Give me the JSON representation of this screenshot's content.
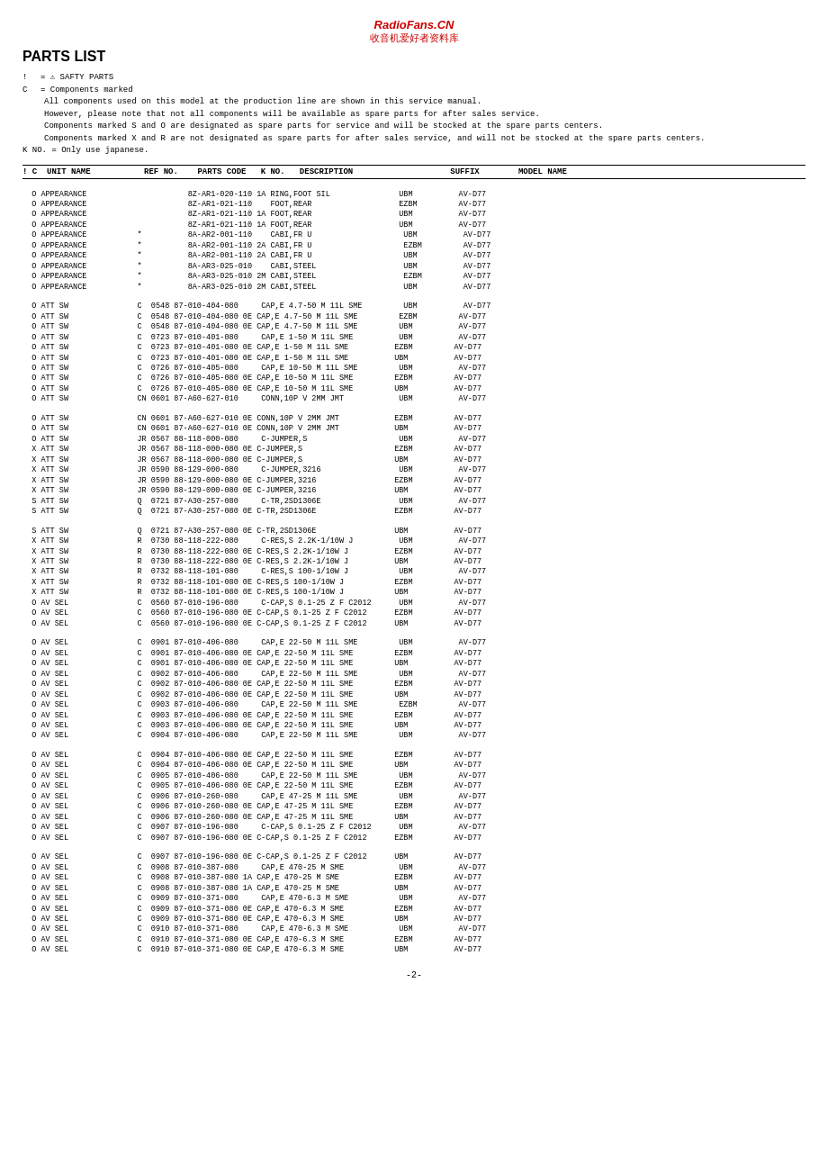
{
  "site": {
    "title": "RadioFans.CN",
    "subtitle": "收音机爱好者资料库"
  },
  "page": {
    "title": "PARTS LIST",
    "page_number": "-2-"
  },
  "legend": {
    "exclamation": "!",
    "c_label": "C",
    "safty": "= ⚠ SAFTY PARTS",
    "components": "= Components marked",
    "note1": "All components used on this model at the production line are shown in this service manual.",
    "note2": "However, please note that not all components will be available as spare parts for after sales service.",
    "note3": "Components marked S and O are designated as spare parts for service and will be stocked at the spare parts centers.",
    "note4": "Components marked X and R are not designated as spare parts for after sales service, and will not be stocked at the spare parts centers.",
    "k_note": "K NO. = Only use japanese."
  },
  "col_header": "! C  UNIT NAME           REF NO.    PARTS CODE   K NO.   DESCRIPTION                    SUFFIX        MODEL NAME",
  "sections": [
    {
      "id": "appearance",
      "lines": [
        "  O APPEARANCE                      8Z-AR1-020-110 1A RING,FOOT SIL               UBM          AV-D77",
        "  O APPEARANCE                      8Z-AR1-021-110    FOOT,REAR                   EZBM         AV-D77",
        "  O APPEARANCE                      8Z-AR1-021-110 1A FOOT,REAR                   UBM          AV-D77",
        "  O APPEARANCE                      8Z-AR1-021-110 1A FOOT,REAR                   UBM          AV-D77",
        "  O APPEARANCE           *          8A-AR2-001-110    CABI,FR U                    UBM          AV-D77",
        "  O APPEARANCE           *          8A-AR2-001-110 2A CABI,FR U                    EZBM         AV-D77",
        "  O APPEARANCE           *          8A-AR2-001-110 2A CABI,FR U                    UBM          AV-D77",
        "  O APPEARANCE           *          8A-AR3-025-010    CABI,STEEL                   UBM          AV-D77",
        "  O APPEARANCE           *          8A-AR3-025-010 2M CABI,STEEL                   EZBM         AV-D77",
        "  O APPEARANCE           *          8A-AR3-025-010 2M CABI,STEEL                   UBM          AV-D77"
      ]
    },
    {
      "id": "att_sw_1",
      "lines": [
        "  O ATT SW               C  0548 87-010-404-080     CAP,E 4.7-50 M 11L SME         UBM          AV-D77",
        "  O ATT SW               C  0548 87-010-404-080 0E CAP,E 4.7-50 M 11L SME         EZBM         AV-D77",
        "  O ATT SW               C  0548 87-010-404-080 0E CAP,E 4.7-50 M 11L SME         UBM          AV-D77",
        "  O ATT SW               C  0723 87-010-401-080     CAP,E 1-50 M 11L SME          UBM          AV-D77",
        "  O ATT SW               C  0723 87-010-401-080 0E CAP,E 1-50 M 11L SME          EZBM         AV-D77",
        "  O ATT SW               C  0723 87-010-401-080 0E CAP,E 1-50 M 11L SME          UBM          AV-D77",
        "  O ATT SW               C  0726 87-010-405-080     CAP,E 10-50 M 11L SME         UBM          AV-D77",
        "  O ATT SW               C  0726 87-010-405-080 0E CAP,E 10-50 M 11L SME         EZBM         AV-D77",
        "  O ATT SW               C  0726 87-010-405-080 0E CAP,E 10-50 M 11L SME         UBM          AV-D77",
        "  O ATT SW               CN 0601 87-A60-627-010     CONN,10P V 2MM JMT            UBM          AV-D77"
      ]
    },
    {
      "id": "att_sw_2",
      "lines": [
        "  O ATT SW               CN 0601 87-A60-627-010 0E CONN,10P V 2MM JMT            EZBM         AV-D77",
        "  O ATT SW               CN 0601 87-A60-627-010 0E CONN,10P V 2MM JMT            UBM          AV-D77",
        "  O ATT SW               JR 0567 88-118-000-080     C-JUMPER,S                    UBM          AV-D77",
        "  X ATT SW               JR 0567 88-118-000-080 0E C-JUMPER,S                    EZBM         AV-D77",
        "  X ATT SW               JR 0567 88-118-000-080 0E C-JUMPER,S                    UBM          AV-D77",
        "  X ATT SW               JR 0590 88-129-000-080     C-JUMPER,3216                 UBM          AV-D77",
        "  X ATT SW               JR 0590 88-129-000-080 0E C-JUMPER,3216                 EZBM         AV-D77",
        "  X ATT SW               JR 0590 88-129-000-080 0E C-JUMPER,3216                 UBM          AV-D77",
        "  S ATT SW               Q  0721 87-A30-257-080     C-TR,2SD1306E                 UBM          AV-D77",
        "  S ATT SW               Q  0721 87-A30-257-080 0E C-TR,2SD1306E                 EZBM         AV-D77"
      ]
    },
    {
      "id": "att_sw_3",
      "lines": [
        "  S ATT SW               Q  0721 87-A30-257-080 0E C-TR,2SD1306E                 UBM          AV-D77",
        "  X ATT SW               R  0730 88-118-222-080     C-RES,S 2.2K-1/10W J          UBM          AV-D77",
        "  X ATT SW               R  0730 88-118-222-080 0E C-RES,S 2.2K-1/10W J          EZBM         AV-D77",
        "  X ATT SW               R  0730 88-118-222-080 0E C-RES,S 2.2K-1/10W J          UBM          AV-D77",
        "  X ATT SW               R  0732 88-118-101-080     C-RES,S 100-1/10W J           UBM          AV-D77",
        "  X ATT SW               R  0732 88-118-101-080 0E C-RES,S 100-1/10W J           EZBM         AV-D77",
        "  X ATT SW               R  0732 88-118-101-080 0E C-RES,S 100-1/10W J           UBM          AV-D77",
        "  O AV SEL               C  0560 87-010-196-080     C-CAP,S 0.1-25 Z F C2012      UBM          AV-D77",
        "  O AV SEL               C  0560 87-010-196-080 0E C-CAP,S 0.1-25 Z F C2012      EZBM         AV-D77",
        "  O AV SEL               C  0560 87-010-196-080 0E C-CAP,S 0.1-25 Z F C2012      UBM          AV-D77"
      ]
    },
    {
      "id": "av_sel_1",
      "lines": [
        "  O AV SEL               C  0901 87-010-406-080     CAP,E 22-50 M 11L SME         UBM          AV-D77",
        "  O AV SEL               C  0901 87-010-406-080 0E CAP,E 22-50 M 11L SME         EZBM         AV-D77",
        "  O AV SEL               C  0901 87-010-406-080 0E CAP,E 22-50 M 11L SME         UBM          AV-D77",
        "  O AV SEL               C  0902 87-010-406-080     CAP,E 22-50 M 11L SME         UBM          AV-D77",
        "  O AV SEL               C  0902 87-010-406-080 0E CAP,E 22-50 M 11L SME         EZBM         AV-D77",
        "  O AV SEL               C  0902 87-010-406-080 0E CAP,E 22-50 M 11L SME         UBM          AV-D77",
        "  O AV SEL               C  0903 87-010-406-080     CAP,E 22-50 M 11L SME         EZBM         AV-D77",
        "  O AV SEL               C  0903 87-010-406-080 0E CAP,E 22-50 M 11L SME         EZBM         AV-D77",
        "  O AV SEL               C  0903 87-010-406-080 0E CAP,E 22-50 M 11L SME         UBM          AV-D77",
        "  O AV SEL               C  0904 87-010-406-080     CAP,E 22-50 M 11L SME         UBM          AV-D77"
      ]
    },
    {
      "id": "av_sel_2",
      "lines": [
        "  O AV SEL               C  0904 87-010-406-080 0E CAP,E 22-50 M 11L SME         EZBM         AV-D77",
        "  O AV SEL               C  0904 87-010-406-080 0E CAP,E 22-50 M 11L SME         UBM          AV-D77",
        "  O AV SEL               C  0905 87-010-406-080     CAP,E 22-50 M 11L SME         UBM          AV-D77",
        "  O AV SEL               C  0905 87-010-406-080 0E CAP,E 22-50 M 11L SME         EZBM         AV-D77",
        "  O AV SEL               C  0906 87-010-260-080     CAP,E 47-25 M 11L SME         UBM          AV-D77",
        "  O AV SEL               C  0906 87-010-260-080 0E CAP,E 47-25 M 11L SME         EZBM         AV-D77",
        "  O AV SEL               C  0906 87-010-260-080 0E CAP,E 47-25 M 11L SME         UBM          AV-D77",
        "  O AV SEL               C  0907 87-010-196-080     C-CAP,S 0.1-25 Z F C2012      UBM          AV-D77",
        "  O AV SEL               C  0907 87-010-196-080 0E C-CAP,S 0.1-25 Z F C2012      EZBM         AV-D77"
      ]
    },
    {
      "id": "av_sel_3",
      "lines": [
        "  O AV SEL               C  0907 87-010-196-080 0E C-CAP,S 0.1-25 Z F C2012      UBM          AV-D77",
        "  O AV SEL               C  0908 87-010-387-080     CAP,E 470-25 M SME            UBM          AV-D77",
        "  O AV SEL               C  0908 87-010-387-080 1A CAP,E 470-25 M SME            EZBM         AV-D77",
        "  O AV SEL               C  0908 87-010-387-080 1A CAP,E 470-25 M SME            UBM          AV-D77",
        "  O AV SEL               C  0909 87-010-371-080     CAP,E 470-6.3 M SME           UBM          AV-D77",
        "  O AV SEL               C  0909 87-010-371-080 0E CAP,E 470-6.3 M SME           EZBM         AV-D77",
        "  O AV SEL               C  0909 87-010-371-080 0E CAP,E 470-6.3 M SME           UBM          AV-D77",
        "  O AV SEL               C  0910 87-010-371-080     CAP,E 470-6.3 M SME           UBM          AV-D77",
        "  O AV SEL               C  0910 87-010-371-080 0E CAP,E 470-6.3 M SME           EZBM         AV-D77",
        "  O AV SEL               C  0910 87-010-371-080 0E CAP,E 470-6.3 M SME           UBM          AV-D77"
      ]
    }
  ]
}
